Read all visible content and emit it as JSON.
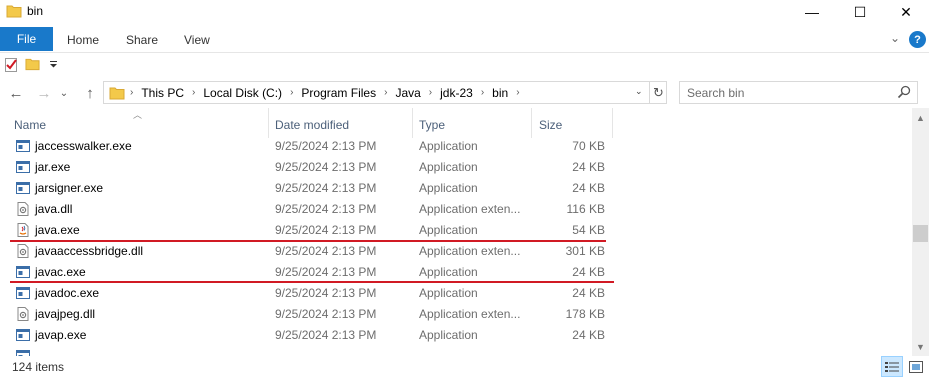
{
  "window": {
    "title": "bin",
    "minimize_glyph": "—",
    "maximize_glyph": "☐",
    "close_glyph": "✕"
  },
  "ribbon": {
    "file": "File",
    "tabs": [
      "Home",
      "Share",
      "View"
    ],
    "expand_glyph": "⌄",
    "help_glyph": "?"
  },
  "nav": {
    "back": "←",
    "forward": "→",
    "recent": "⌄",
    "up": "↑"
  },
  "address": {
    "crumbs": [
      "This PC",
      "Local Disk (C:)",
      "Program Files",
      "Java",
      "jdk-23",
      "bin"
    ],
    "separator": "›",
    "dropdown_glyph": "⌄",
    "refresh_glyph": "↻"
  },
  "search": {
    "placeholder": "Search bin"
  },
  "columns": {
    "name": "Name",
    "date": "Date modified",
    "type": "Type",
    "size": "Size"
  },
  "files": [
    {
      "name": "jaccesswalker.exe",
      "date": "9/25/2024 2:13 PM",
      "type": "Application",
      "size": "70 KB",
      "icon": "exe-icon"
    },
    {
      "name": "jar.exe",
      "date": "9/25/2024 2:13 PM",
      "type": "Application",
      "size": "24 KB",
      "icon": "exe-icon"
    },
    {
      "name": "jarsigner.exe",
      "date": "9/25/2024 2:13 PM",
      "type": "Application",
      "size": "24 KB",
      "icon": "exe-icon"
    },
    {
      "name": "java.dll",
      "date": "9/25/2024 2:13 PM",
      "type": "Application exten...",
      "size": "116 KB",
      "icon": "dll-icon"
    },
    {
      "name": "java.exe",
      "date": "9/25/2024 2:13 PM",
      "type": "Application",
      "size": "54 KB",
      "icon": "java-icon"
    },
    {
      "name": "javaaccessbridge.dll",
      "date": "9/25/2024 2:13 PM",
      "type": "Application exten...",
      "size": "301 KB",
      "icon": "dll-icon"
    },
    {
      "name": "javac.exe",
      "date": "9/25/2024 2:13 PM",
      "type": "Application",
      "size": "24 KB",
      "icon": "exe-icon"
    },
    {
      "name": "javadoc.exe",
      "date": "9/25/2024 2:13 PM",
      "type": "Application",
      "size": "24 KB",
      "icon": "exe-icon"
    },
    {
      "name": "javajpeg.dll",
      "date": "9/25/2024 2:13 PM",
      "type": "Application exten...",
      "size": "178 KB",
      "icon": "dll-icon"
    },
    {
      "name": "javap.exe",
      "date": "9/25/2024 2:13 PM",
      "type": "Application",
      "size": "24 KB",
      "icon": "exe-icon"
    },
    {
      "name": "",
      "date": "",
      "type": "",
      "size": "",
      "icon": "exe-icon"
    }
  ],
  "status": {
    "item_count": "124 items"
  },
  "colors": {
    "accent": "#1979ca",
    "highlight": "#d11a24",
    "folder": "#f3c94a"
  }
}
